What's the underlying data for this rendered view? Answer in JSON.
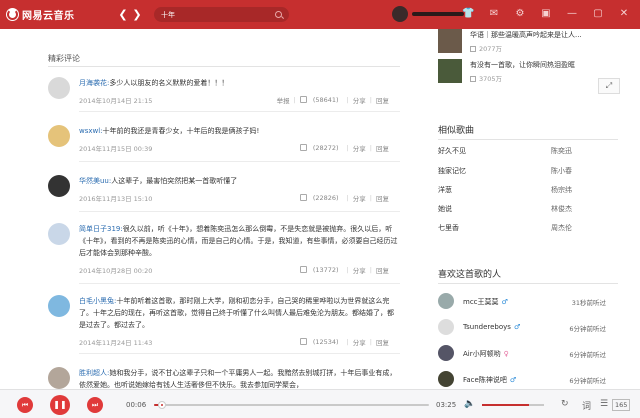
{
  "app": {
    "name": "网易云音乐"
  },
  "search": {
    "value": "十年"
  },
  "colors": {
    "brand": "#c62f2f",
    "link": "#2b6cb0"
  },
  "comments_section": {
    "title": "精彩评论",
    "items": [
      {
        "user": "月海袭花:",
        "text": "多少人以朋友的名义默默的爱着！！！",
        "time": "2014年10月14日 21:15",
        "report": "举报",
        "likes": "(58641)",
        "share": "分享",
        "reply": "回复"
      },
      {
        "user": "wsxwl:",
        "text": "十年前的我还是青春少女，十年后的我是俩孩子妈!",
        "time": "2014年11月15日 00:39",
        "report": "",
        "likes": "(28272)",
        "share": "分享",
        "reply": "回复"
      },
      {
        "user": "华然美uu:",
        "text": "人这辈子，最害怕突然把某一首歌听懂了",
        "time": "2016年11月13日 15:10",
        "report": "",
        "likes": "(22826)",
        "share": "分享",
        "reply": "回复"
      },
      {
        "user": "简单日子319:",
        "text": "很久以前，听《十年》，想着陈奕迅怎么那么倒霉，不是失恋就是被抛弃。很久以后，听《十年》，看到的不再是陈奕迅的心情，而是自己的心情。于是，我知道，有些事情，必须要自己经历过后才能体会到那种辛酸。",
        "time": "2014年10月28日 00:20",
        "report": "",
        "likes": "(13772)",
        "share": "分享",
        "reply": "回复"
      },
      {
        "user": "白毛小黑兔:",
        "text": "十年前听着这首歌，那时刚上大学，刚和初恋分手，自己哭的稀里哗啦以为世界就这么完了。十年之后的现在，再听这首歌，觉得自己终于听懂了什么叫情人最后难免沦为朋友。都结婚了，都是过去了。都过去了。",
        "time": "2014年11月24日 11:43",
        "report": "",
        "likes": "(12534)",
        "share": "分享",
        "reply": "回复"
      },
      {
        "user": "胜利超人:",
        "text": "她和我分手，说不甘心这辈子只和一个平庸男人一起。我黯然去别城打拼，十年后事业有成，依然爱她。也听说她嫁给有钱人生活奢侈但不快乐。我去参加同学聚会，",
        "time": "",
        "report": "",
        "likes": "",
        "share": "",
        "reply": ""
      }
    ]
  },
  "right": {
    "videos": [
      {
        "title": "华语｜那些温暖高声吟起来是让人...",
        "plays": "2077万"
      },
      {
        "title": "有没有一首歌，让你瞬间热泪盈眶",
        "plays": "3705万"
      }
    ],
    "similar_title": "相似歌曲",
    "similar_songs": [
      {
        "name": "好久不见",
        "artist": "陈奕迅"
      },
      {
        "name": "独家记忆",
        "artist": "陈小春"
      },
      {
        "name": "洋葱",
        "artist": "杨宗纬"
      },
      {
        "name": "她说",
        "artist": "林俊杰"
      },
      {
        "name": "七里香",
        "artist": "周杰伦"
      }
    ],
    "likers_title": "喜欢这首歌的人",
    "likers": [
      {
        "name": "mcc王莫莫",
        "sex": "♂",
        "time": "31秒前听过"
      },
      {
        "name": "Tsundereboys",
        "sex": "♂",
        "time": "6分钟前听过"
      },
      {
        "name": "Air小阿顿哟",
        "sex": "♀",
        "time": "6分钟前听过"
      },
      {
        "name": "Face陈神说吧",
        "sex": "♂",
        "time": "6分钟前听过"
      }
    ]
  },
  "player": {
    "current_time": "00:06",
    "total_time": "03:25",
    "progress": 0.03,
    "volume": 0.75,
    "queue_count": "165"
  }
}
